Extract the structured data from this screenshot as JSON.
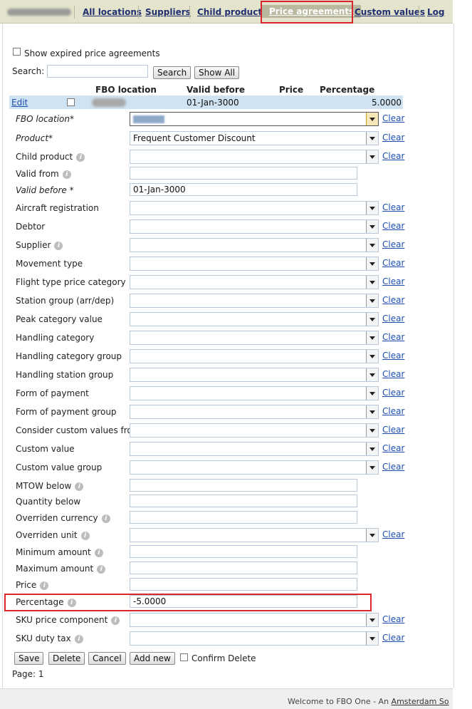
{
  "tabs": [
    "All locations",
    "Suppliers",
    "Child products",
    "Price agreements",
    "Custom values",
    "Log"
  ],
  "active_tab": "Price agreements",
  "filters": {
    "show_expired_label": "Show expired price agreements",
    "search_label": "Search:",
    "search_value": "",
    "search_button": "Search",
    "show_all_button": "Show All"
  },
  "table": {
    "headers": [
      "FBO location",
      "Valid before",
      "Price",
      "Percentage"
    ],
    "row": {
      "edit": "Edit",
      "fbo_location": "",
      "valid_before": "01-Jan-3000",
      "price": "",
      "percentage": "5.0000"
    }
  },
  "form": {
    "clear_label": "Clear",
    "fields": [
      {
        "label": "FBO location*",
        "type": "select",
        "value": ""
      },
      {
        "label": "Product*",
        "type": "select",
        "value": "Frequent Customer Discount"
      },
      {
        "label": "Child product",
        "type": "select",
        "value": ""
      },
      {
        "label": "Valid from",
        "type": "input",
        "value": ""
      },
      {
        "label": "Valid before *",
        "type": "input",
        "value": "01-Jan-3000"
      },
      {
        "label": "Aircraft registration",
        "type": "select",
        "value": ""
      },
      {
        "label": "Debtor",
        "type": "select",
        "value": ""
      },
      {
        "label": "Supplier",
        "type": "select",
        "value": ""
      },
      {
        "label": "Movement type",
        "type": "select",
        "value": ""
      },
      {
        "label": "Flight type price category",
        "type": "select",
        "value": ""
      },
      {
        "label": "Station group (arr/dep)",
        "type": "select",
        "value": ""
      },
      {
        "label": "Peak category value",
        "type": "select",
        "value": ""
      },
      {
        "label": "Handling category",
        "type": "select",
        "value": ""
      },
      {
        "label": "Handling category group",
        "type": "select",
        "value": ""
      },
      {
        "label": "Handling station group",
        "type": "select",
        "value": ""
      },
      {
        "label": "Form of payment",
        "type": "select",
        "value": ""
      },
      {
        "label": "Form of payment group",
        "type": "select",
        "value": ""
      },
      {
        "label": "Consider custom values from",
        "type": "select",
        "value": ""
      },
      {
        "label": "Custom value",
        "type": "select",
        "value": ""
      },
      {
        "label": "Custom value group",
        "type": "select",
        "value": ""
      },
      {
        "label": "MTOW below",
        "type": "input",
        "value": ""
      },
      {
        "label": "Quantity below",
        "type": "input",
        "value": ""
      },
      {
        "label": "Overriden currency",
        "type": "input",
        "value": ""
      },
      {
        "label": "Overriden unit",
        "type": "select",
        "value": ""
      },
      {
        "label": "Minimum amount",
        "type": "input",
        "value": ""
      },
      {
        "label": "Maximum amount",
        "type": "input",
        "value": ""
      },
      {
        "label": "Price",
        "type": "input",
        "value": ""
      },
      {
        "label": "Percentage",
        "type": "input",
        "value": "-5.0000"
      },
      {
        "label": "SKU price component",
        "type": "select",
        "value": ""
      },
      {
        "label": "SKU duty tax",
        "type": "select",
        "value": ""
      }
    ]
  },
  "actions": {
    "save": "Save",
    "delete": "Delete",
    "cancel": "Cancel",
    "add_new": "Add new",
    "confirm_delete": "Confirm Delete"
  },
  "pager": "Page: 1",
  "footer": {
    "prefix": "Welcome to FBO One - An ",
    "link": "Amsterdam So"
  },
  "colors": {
    "accent_red": "#d8262c",
    "tab_bar": "#e4e4cc",
    "selected_row": "#cfe3f3",
    "link": "#1e4fb0"
  }
}
